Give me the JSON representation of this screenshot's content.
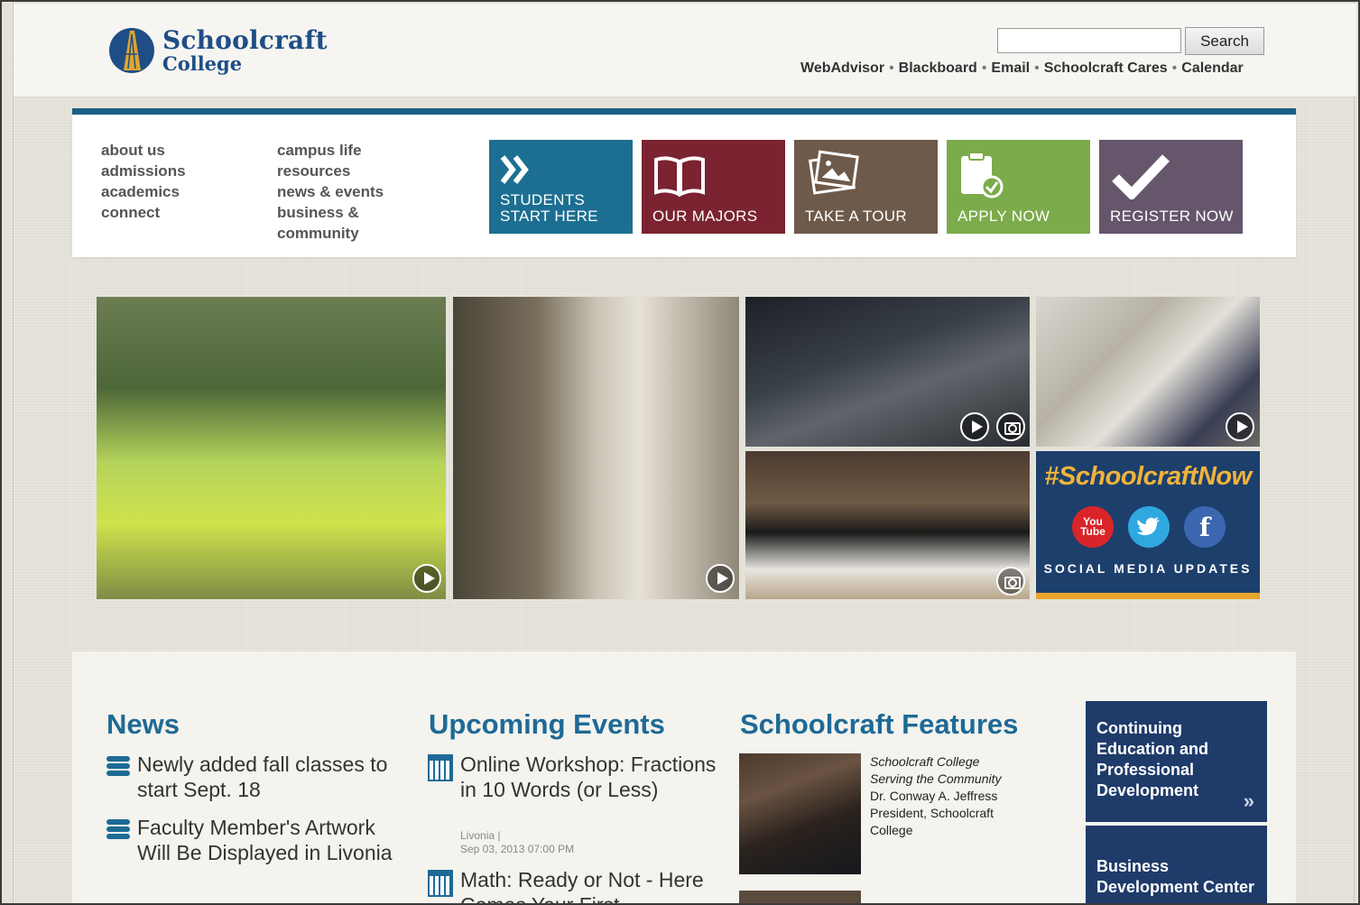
{
  "header": {
    "logo_line1": "Schoolcraft",
    "logo_line2": "College",
    "search_button": "Search",
    "util_links": [
      "WebAdvisor",
      "Blackboard",
      "Email",
      "Schoolcraft Cares",
      "Calendar"
    ]
  },
  "nav": {
    "col1": [
      "about us",
      "admissions",
      "academics",
      "connect"
    ],
    "col2": [
      "campus life",
      "resources",
      "news & events",
      "business &",
      "community"
    ]
  },
  "tiles": {
    "students_l1": "STUDENTS",
    "students_l2": "START HERE",
    "majors": "OUR MAJORS",
    "tour": "TAKE A TOUR",
    "apply": "APPLY NOW",
    "register": "REGISTER NOW"
  },
  "social": {
    "hashtag": "#SchoolcraftNow",
    "label": "SOCIAL MEDIA UPDATES",
    "youtube_l1": "You",
    "youtube_l2": "Tube",
    "facebook": "f"
  },
  "news": {
    "title": "News",
    "items": [
      "Newly added fall classes to start Sept. 18",
      "Faculty Member's Artwork Will Be Displayed in Livonia"
    ]
  },
  "events": {
    "title": "Upcoming Events",
    "items": [
      {
        "title": "Online Workshop: Fractions in 10 Words (or Less)",
        "location": "Livonia |",
        "date": "Sep 03, 2013 07:00 PM"
      },
      {
        "title": "Math: Ready or Not - Here Comes Your First"
      }
    ]
  },
  "features": {
    "title": "Schoolcraft Features",
    "caption_italic_1": "Schoolcraft College",
    "caption_italic_2": "Serving the Community",
    "caption_1": "Dr. Conway A. Jeffress",
    "caption_2": "President, Schoolcraft",
    "caption_3": "College"
  },
  "sidebar": {
    "box1": "Continuing Education and Professional Development",
    "box1_chevron": "»",
    "box2": "Business Development Center"
  },
  "colors": {
    "accent_blue": "#1e6a96",
    "tile_students": "#1c6f92",
    "tile_majors": "#7b2330",
    "tile_tour": "#6e5a4a",
    "tile_apply": "#7bab4a",
    "tile_register": "#65566b"
  }
}
